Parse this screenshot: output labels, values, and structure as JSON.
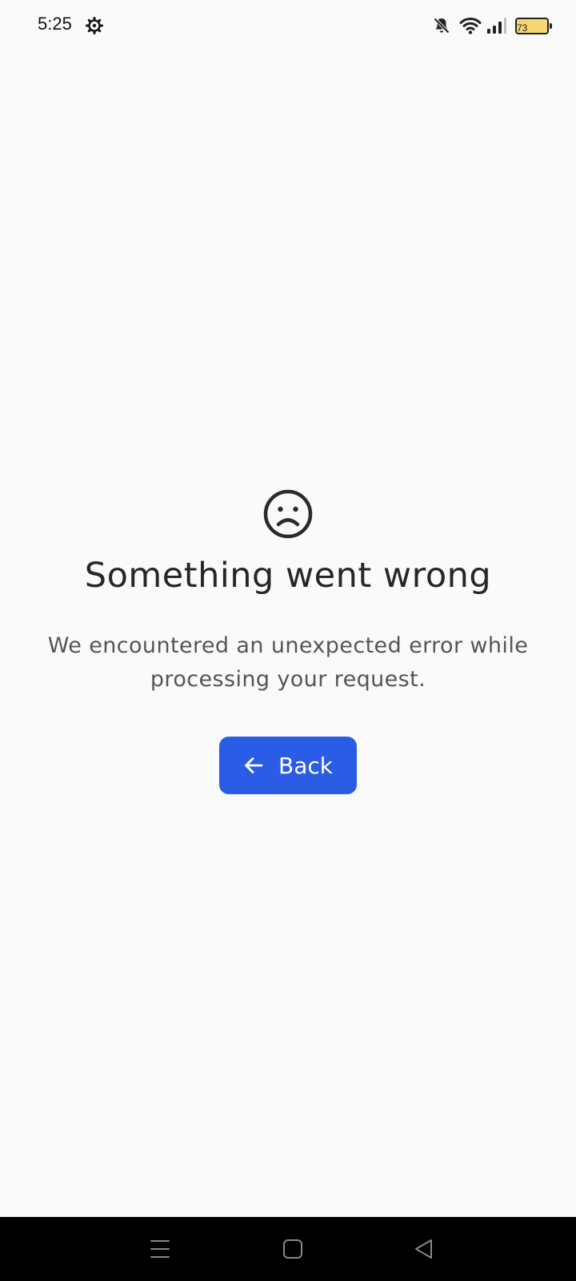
{
  "status_bar": {
    "time": "5:25",
    "battery_level": "73",
    "icons": [
      "settings-icon",
      "mute-icon",
      "wifi-icon",
      "signal-icon",
      "battery-icon"
    ]
  },
  "error": {
    "icon": "sad-face-icon",
    "title": "Something went wrong",
    "message": "We encountered an unexpected error while processing your request."
  },
  "actions": {
    "back_label": "Back",
    "back_icon": "arrow-left-icon"
  },
  "nav_bar": {
    "icons": [
      "menu-icon",
      "home-icon",
      "back-icon"
    ]
  },
  "colors": {
    "background": "#fafafa",
    "accent": "#2b5ce6",
    "title": "#262626",
    "message": "#555555",
    "battery_fill": "#f6d774"
  }
}
